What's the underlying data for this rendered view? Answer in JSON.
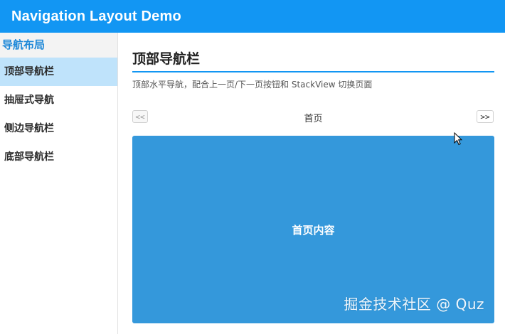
{
  "window": {
    "title": "Navigation Layout Demo"
  },
  "sidebar": {
    "header": "导航布局",
    "items": [
      {
        "label": "顶部导航栏",
        "active": true
      },
      {
        "label": "抽屉式导航",
        "active": false
      },
      {
        "label": "侧边导航栏",
        "active": false
      },
      {
        "label": "底部导航栏",
        "active": false
      }
    ]
  },
  "main": {
    "title": "顶部导航栏",
    "description": "顶部水平导航，配合上一页/下一页按钮和 StackView 切换页面",
    "prev_label": "<<",
    "next_label": ">>",
    "current_page": "首页",
    "content_text": "首页内容"
  },
  "watermark": {
    "text": "掘金技术社区 @ Quz"
  },
  "colors": {
    "titlebar": "#1296f3",
    "sidebar_active": "#bfe3fb",
    "sidebar_header_text": "#1e88d8",
    "content_panel": "#3498db"
  },
  "icons": {
    "cursor": "mouse-pointer-icon"
  }
}
